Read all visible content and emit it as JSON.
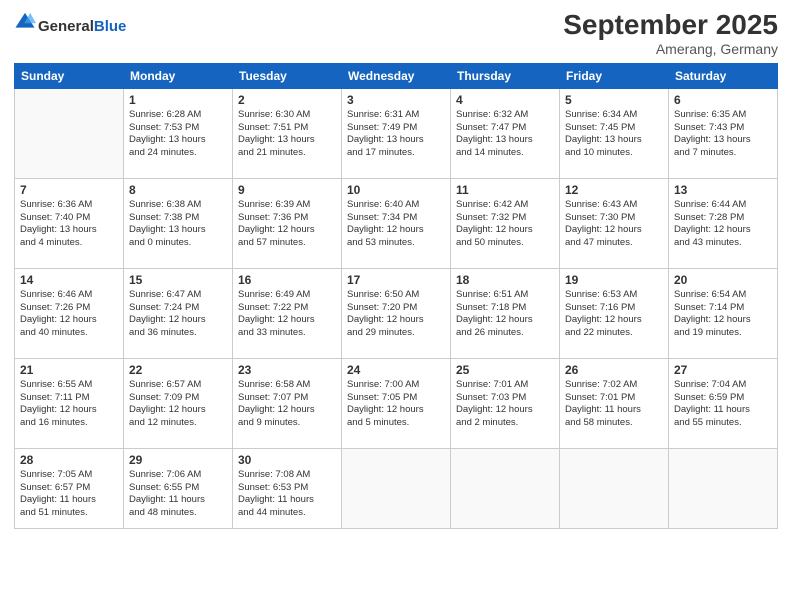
{
  "header": {
    "logo": {
      "general": "General",
      "blue": "Blue"
    },
    "title": "September 2025",
    "subtitle": "Amerang, Germany"
  },
  "days": [
    "Sunday",
    "Monday",
    "Tuesday",
    "Wednesday",
    "Thursday",
    "Friday",
    "Saturday"
  ],
  "weeks": [
    [
      {
        "date": "",
        "info": ""
      },
      {
        "date": "1",
        "info": "Sunrise: 6:28 AM\nSunset: 7:53 PM\nDaylight: 13 hours\nand 24 minutes."
      },
      {
        "date": "2",
        "info": "Sunrise: 6:30 AM\nSunset: 7:51 PM\nDaylight: 13 hours\nand 21 minutes."
      },
      {
        "date": "3",
        "info": "Sunrise: 6:31 AM\nSunset: 7:49 PM\nDaylight: 13 hours\nand 17 minutes."
      },
      {
        "date": "4",
        "info": "Sunrise: 6:32 AM\nSunset: 7:47 PM\nDaylight: 13 hours\nand 14 minutes."
      },
      {
        "date": "5",
        "info": "Sunrise: 6:34 AM\nSunset: 7:45 PM\nDaylight: 13 hours\nand 10 minutes."
      },
      {
        "date": "6",
        "info": "Sunrise: 6:35 AM\nSunset: 7:43 PM\nDaylight: 13 hours\nand 7 minutes."
      }
    ],
    [
      {
        "date": "7",
        "info": "Sunrise: 6:36 AM\nSunset: 7:40 PM\nDaylight: 13 hours\nand 4 minutes."
      },
      {
        "date": "8",
        "info": "Sunrise: 6:38 AM\nSunset: 7:38 PM\nDaylight: 13 hours\nand 0 minutes."
      },
      {
        "date": "9",
        "info": "Sunrise: 6:39 AM\nSunset: 7:36 PM\nDaylight: 12 hours\nand 57 minutes."
      },
      {
        "date": "10",
        "info": "Sunrise: 6:40 AM\nSunset: 7:34 PM\nDaylight: 12 hours\nand 53 minutes."
      },
      {
        "date": "11",
        "info": "Sunrise: 6:42 AM\nSunset: 7:32 PM\nDaylight: 12 hours\nand 50 minutes."
      },
      {
        "date": "12",
        "info": "Sunrise: 6:43 AM\nSunset: 7:30 PM\nDaylight: 12 hours\nand 47 minutes."
      },
      {
        "date": "13",
        "info": "Sunrise: 6:44 AM\nSunset: 7:28 PM\nDaylight: 12 hours\nand 43 minutes."
      }
    ],
    [
      {
        "date": "14",
        "info": "Sunrise: 6:46 AM\nSunset: 7:26 PM\nDaylight: 12 hours\nand 40 minutes."
      },
      {
        "date": "15",
        "info": "Sunrise: 6:47 AM\nSunset: 7:24 PM\nDaylight: 12 hours\nand 36 minutes."
      },
      {
        "date": "16",
        "info": "Sunrise: 6:49 AM\nSunset: 7:22 PM\nDaylight: 12 hours\nand 33 minutes."
      },
      {
        "date": "17",
        "info": "Sunrise: 6:50 AM\nSunset: 7:20 PM\nDaylight: 12 hours\nand 29 minutes."
      },
      {
        "date": "18",
        "info": "Sunrise: 6:51 AM\nSunset: 7:18 PM\nDaylight: 12 hours\nand 26 minutes."
      },
      {
        "date": "19",
        "info": "Sunrise: 6:53 AM\nSunset: 7:16 PM\nDaylight: 12 hours\nand 22 minutes."
      },
      {
        "date": "20",
        "info": "Sunrise: 6:54 AM\nSunset: 7:14 PM\nDaylight: 12 hours\nand 19 minutes."
      }
    ],
    [
      {
        "date": "21",
        "info": "Sunrise: 6:55 AM\nSunset: 7:11 PM\nDaylight: 12 hours\nand 16 minutes."
      },
      {
        "date": "22",
        "info": "Sunrise: 6:57 AM\nSunset: 7:09 PM\nDaylight: 12 hours\nand 12 minutes."
      },
      {
        "date": "23",
        "info": "Sunrise: 6:58 AM\nSunset: 7:07 PM\nDaylight: 12 hours\nand 9 minutes."
      },
      {
        "date": "24",
        "info": "Sunrise: 7:00 AM\nSunset: 7:05 PM\nDaylight: 12 hours\nand 5 minutes."
      },
      {
        "date": "25",
        "info": "Sunrise: 7:01 AM\nSunset: 7:03 PM\nDaylight: 12 hours\nand 2 minutes."
      },
      {
        "date": "26",
        "info": "Sunrise: 7:02 AM\nSunset: 7:01 PM\nDaylight: 11 hours\nand 58 minutes."
      },
      {
        "date": "27",
        "info": "Sunrise: 7:04 AM\nSunset: 6:59 PM\nDaylight: 11 hours\nand 55 minutes."
      }
    ],
    [
      {
        "date": "28",
        "info": "Sunrise: 7:05 AM\nSunset: 6:57 PM\nDaylight: 11 hours\nand 51 minutes."
      },
      {
        "date": "29",
        "info": "Sunrise: 7:06 AM\nSunset: 6:55 PM\nDaylight: 11 hours\nand 48 minutes."
      },
      {
        "date": "30",
        "info": "Sunrise: 7:08 AM\nSunset: 6:53 PM\nDaylight: 11 hours\nand 44 minutes."
      },
      {
        "date": "",
        "info": ""
      },
      {
        "date": "",
        "info": ""
      },
      {
        "date": "",
        "info": ""
      },
      {
        "date": "",
        "info": ""
      }
    ]
  ]
}
